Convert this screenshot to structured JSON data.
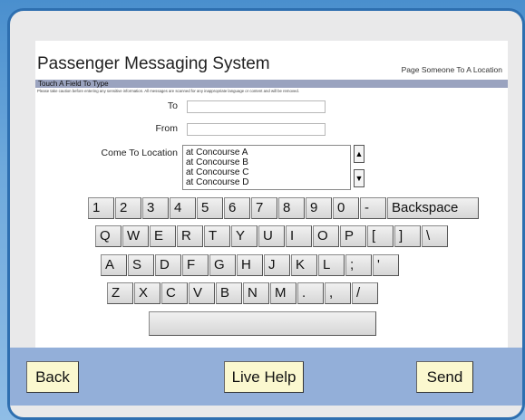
{
  "header": {
    "title": "Passenger Messaging System",
    "right_label": "Page Someone To A Location"
  },
  "band": {
    "text": "Touch A Field To Type"
  },
  "warning": "Please take caution before entering any sensitive information. All messages are scanned for any inappropriate language or content and will be removed.",
  "form": {
    "to_label": "To",
    "to_value": "",
    "from_label": "From",
    "from_value": "",
    "location_label": "Come To Location",
    "locations": [
      "at Concourse A",
      "at Concourse B",
      "at Concourse C",
      "at Concourse D"
    ],
    "scroll_up_icon": "triangle-up",
    "scroll_down_icon": "triangle-down"
  },
  "keyboard": {
    "row1": [
      "1",
      "2",
      "3",
      "4",
      "5",
      "6",
      "7",
      "8",
      "9",
      "0",
      "-",
      "Backspace"
    ],
    "row2": [
      "Q",
      "W",
      "E",
      "R",
      "T",
      "Y",
      "U",
      "I",
      "O",
      "P",
      "[",
      "]",
      "\\"
    ],
    "row3": [
      "A",
      "S",
      "D",
      "F",
      "G",
      "H",
      "J",
      "K",
      "L",
      ";",
      "'"
    ],
    "row4": [
      "Z",
      "X",
      "C",
      "V",
      "B",
      "N",
      "M",
      ".",
      ",",
      "/"
    ],
    "space_label": ""
  },
  "footer": {
    "back_label": "Back",
    "help_label": "Live Help",
    "send_label": "Send"
  },
  "colors": {
    "frame_border": "#2e6fb0",
    "band": "#9aa3bf",
    "footer": "#93afd9",
    "footer_button": "#fbf8cf"
  }
}
